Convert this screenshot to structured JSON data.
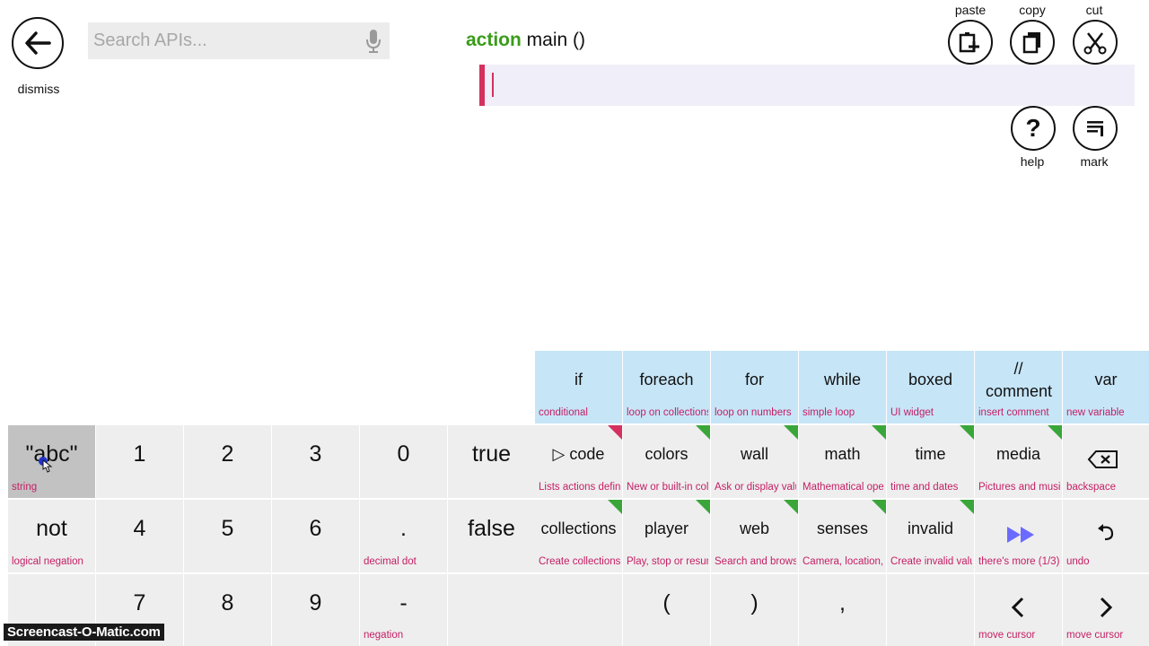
{
  "top": {
    "dismiss_label": "dismiss",
    "search_placeholder": "Search APIs...",
    "header_keyword": "action",
    "header_rest": " main ()",
    "paste_label": "paste",
    "copy_label": "copy",
    "cut_label": "cut",
    "help_label": "help",
    "mark_label": "mark"
  },
  "keyboard": {
    "row1": [
      {
        "main": "if",
        "sub": "conditional"
      },
      {
        "main": "foreach",
        "sub": "loop on collections"
      },
      {
        "main": "for",
        "sub": "loop on numbers"
      },
      {
        "main": "while",
        "sub": "simple loop"
      },
      {
        "main": "boxed",
        "sub": "UI widget"
      },
      {
        "main": "// comment",
        "sub": "insert comment"
      },
      {
        "main": "var",
        "sub": "new variable"
      }
    ],
    "row2": [
      {
        "main": "\"abc\"",
        "sub": "string"
      },
      {
        "main": "1",
        "sub": ""
      },
      {
        "main": "2",
        "sub": ""
      },
      {
        "main": "3",
        "sub": ""
      },
      {
        "main": "0",
        "sub": ""
      },
      {
        "main": "true",
        "sub": ""
      },
      {
        "main": "▷ code",
        "sub": "Lists actions defined"
      },
      {
        "main": "colors",
        "sub": "New or built-in colors"
      },
      {
        "main": "wall",
        "sub": "Ask or display values"
      },
      {
        "main": "math",
        "sub": "Mathematical operations"
      },
      {
        "main": "time",
        "sub": "time and dates"
      },
      {
        "main": "media",
        "sub": "Pictures and music"
      },
      {
        "main": "",
        "sub": "backspace"
      }
    ],
    "row3": [
      {
        "main": "not",
        "sub": "logical negation"
      },
      {
        "main": "4",
        "sub": ""
      },
      {
        "main": "5",
        "sub": ""
      },
      {
        "main": "6",
        "sub": ""
      },
      {
        "main": ".",
        "sub": "decimal dot"
      },
      {
        "main": "false",
        "sub": ""
      },
      {
        "main": "collections",
        "sub": "Create collections"
      },
      {
        "main": "player",
        "sub": "Play, stop or resume"
      },
      {
        "main": "web",
        "sub": "Search and browse"
      },
      {
        "main": "senses",
        "sub": "Camera, location, ..."
      },
      {
        "main": "invalid",
        "sub": "Create invalid values"
      },
      {
        "main": "",
        "sub": "there's more (1/3)"
      },
      {
        "main": "",
        "sub": "undo"
      }
    ],
    "row4": [
      {
        "main": "",
        "sub": ""
      },
      {
        "main": "7",
        "sub": ""
      },
      {
        "main": "8",
        "sub": ""
      },
      {
        "main": "9",
        "sub": ""
      },
      {
        "main": "-",
        "sub": "negation"
      },
      {
        "main": "",
        "sub": ""
      },
      {
        "main": "",
        "sub": ""
      },
      {
        "main": "(",
        "sub": ""
      },
      {
        "main": ")",
        "sub": ""
      },
      {
        "main": ",",
        "sub": ""
      },
      {
        "main": "",
        "sub": ""
      },
      {
        "main": "",
        "sub": "move cursor"
      },
      {
        "main": "",
        "sub": "move cursor"
      }
    ]
  },
  "icons": {
    "back": "arrow-left-icon",
    "mic": "microphone-icon",
    "paste": "paste-icon",
    "copy": "copy-icon",
    "cut": "scissors-icon",
    "help": "question-icon",
    "mark": "mark-icon",
    "backspace": "backspace-icon",
    "more": "fast-forward-icon",
    "undo": "undo-icon",
    "left": "chevron-left-icon",
    "right": "chevron-right-icon"
  },
  "colors": {
    "keyword_green": "#3a9c1a",
    "accent_pink": "#d4315e",
    "sub_text": "#c41e64",
    "key_blue": "#c6e5f7",
    "key_gray": "#eeeeee"
  },
  "watermark": "Screencast-O-Matic.com"
}
